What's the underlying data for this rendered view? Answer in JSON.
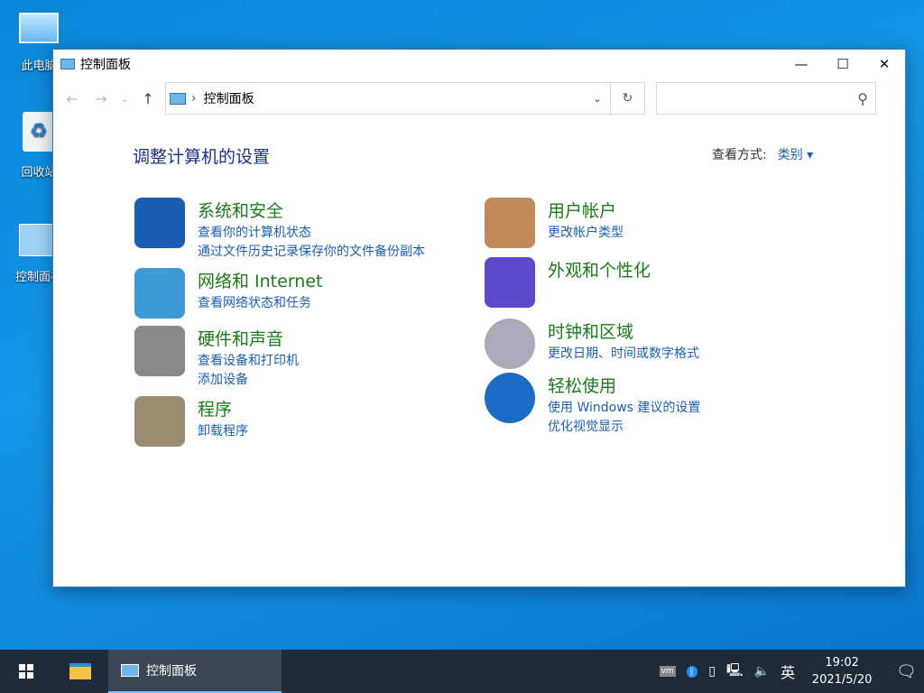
{
  "desktop": {
    "icons": [
      {
        "label": "此电脑"
      },
      {
        "label": "回收站"
      },
      {
        "label": "控制面板"
      }
    ]
  },
  "window": {
    "title": "控制面板",
    "controls": {
      "minimize": "—",
      "maximize": "☐",
      "close": "✕"
    }
  },
  "nav": {
    "back": "←",
    "forward": "→",
    "recent": "⌄",
    "up": "↑",
    "address": "控制面板",
    "search_placeholder": ""
  },
  "heading": "调整计算机的设置",
  "view_by": {
    "label": "查看方式:",
    "value": "类别 ▾"
  },
  "categories": [
    {
      "title": "系统和安全",
      "links": [
        "查看你的计算机状态",
        "通过文件历史记录保存你的文件备份副本"
      ],
      "icon": "shield-icon"
    },
    {
      "title": "网络和 Internet",
      "links": [
        "查看网络状态和任务"
      ],
      "icon": "network-icon"
    },
    {
      "title": "硬件和声音",
      "links": [
        "查看设备和打印机",
        "添加设备"
      ],
      "icon": "printer-icon"
    },
    {
      "title": "程序",
      "links": [
        "卸载程序"
      ],
      "icon": "programs-icon"
    },
    {
      "title": "用户帐户",
      "links": [
        "更改帐户类型"
      ],
      "icon": "users-icon"
    },
    {
      "title": "外观和个性化",
      "links": [],
      "icon": "appearance-icon"
    },
    {
      "title": "时钟和区域",
      "links": [
        "更改日期、时间或数字格式"
      ],
      "icon": "clock-icon"
    },
    {
      "title": "轻松使用",
      "links": [
        "使用 Windows 建议的设置",
        "优化视觉显示"
      ],
      "icon": "ease-of-access-icon"
    }
  ],
  "taskbar": {
    "app": "控制面板",
    "ime": "英",
    "time": "19:02",
    "date": "2021/5/20"
  }
}
